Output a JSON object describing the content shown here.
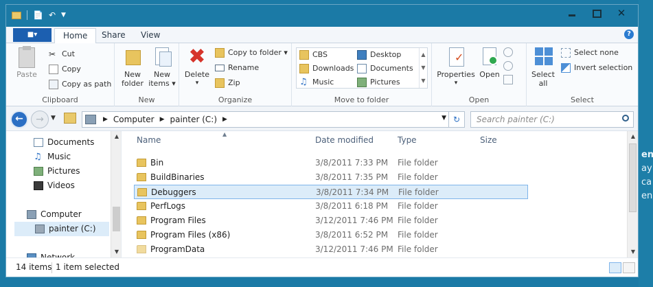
{
  "ribbon": {
    "file_tab": "■▾",
    "tabs": [
      "Home",
      "Share",
      "View"
    ],
    "help": "?",
    "clipboard": {
      "paste": "Paste",
      "cut": "Cut",
      "copy": "Copy",
      "copy_as_path": "Copy as path",
      "label": "Clipboard"
    },
    "new": {
      "new_folder": [
        "New",
        "folder"
      ],
      "new_items": [
        "New",
        "items ▾"
      ],
      "label": "New"
    },
    "organize": {
      "delete": "Delete",
      "delete_arrow": "▾",
      "copy_to_folder": "Copy to folder ▾",
      "rename": "Rename",
      "zip": "Zip",
      "label": "Organize"
    },
    "move_to_folder": {
      "items": [
        "CBS",
        "Desktop",
        "Downloads",
        "Documents",
        "Music",
        "Pictures"
      ],
      "label": "Move to folder"
    },
    "open": {
      "properties": "Properties",
      "properties_arrow": "▾",
      "open": "Open",
      "label": "Open"
    },
    "select": {
      "select_all": [
        "Select",
        "all"
      ],
      "select_none": "Select none",
      "invert_selection": "Invert selection",
      "label": "Select"
    }
  },
  "address": {
    "crumbs": [
      "Computer",
      "painter (C:)"
    ],
    "search_placeholder": "Search painter (C:)"
  },
  "navpane": {
    "items": [
      "Documents",
      "Music",
      "Pictures",
      "Videos",
      "Computer",
      "painter (C:)",
      "Network"
    ],
    "selected": "painter (C:)"
  },
  "columns": [
    "Name",
    "Date modified",
    "Type",
    "Size"
  ],
  "files": [
    {
      "name": "Bin",
      "date": "3/8/2011 7:33 PM",
      "type": "File folder"
    },
    {
      "name": "BuildBinaries",
      "date": "3/8/2011 7:35 PM",
      "type": "File folder"
    },
    {
      "name": "Debuggers",
      "date": "3/8/2011 7:34 PM",
      "type": "File folder"
    },
    {
      "name": "PerfLogs",
      "date": "3/8/2011 6:18 PM",
      "type": "File folder"
    },
    {
      "name": "Program Files",
      "date": "3/12/2011 7:46 PM",
      "type": "File folder"
    },
    {
      "name": "Program Files (x86)",
      "date": "3/8/2011 6:52 PM",
      "type": "File folder"
    },
    {
      "name": "ProgramData",
      "date": "3/12/2011 7:46 PM",
      "type": "File folder"
    }
  ],
  "selected_file": "Debuggers",
  "status": {
    "count": "14 items",
    "selection": "1 item selected"
  },
  "background_text": [
    "en",
    "ay",
    "ca",
    "en"
  ]
}
